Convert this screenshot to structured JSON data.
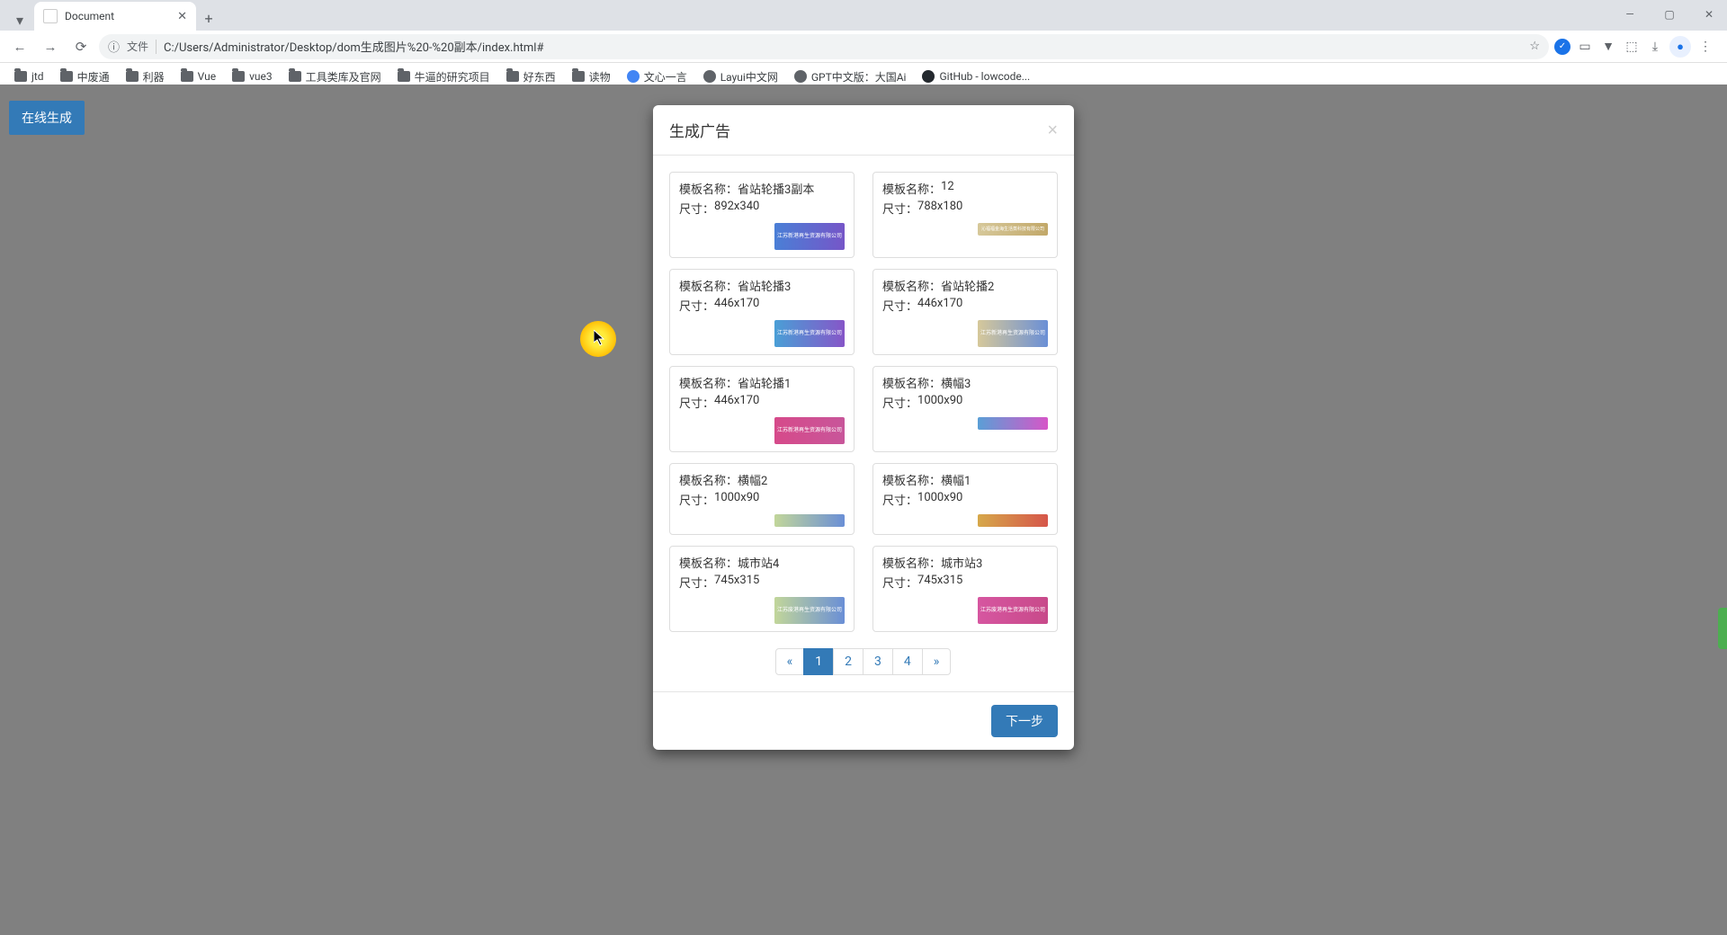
{
  "browser": {
    "tab_title": "Document",
    "url_file_label": "文件",
    "url": "C:/Users/Administrator/Desktop/dom生成图片%20-%20副本/index.html#",
    "bookmarks": [
      {
        "label": "jtd",
        "icon": "folder"
      },
      {
        "label": "中废通",
        "icon": "folder"
      },
      {
        "label": "利器",
        "icon": "folder"
      },
      {
        "label": "Vue",
        "icon": "folder"
      },
      {
        "label": "vue3",
        "icon": "folder"
      },
      {
        "label": "工具类库及官网",
        "icon": "folder"
      },
      {
        "label": "牛逼的研究项目",
        "icon": "folder"
      },
      {
        "label": "好东西",
        "icon": "folder"
      },
      {
        "label": "读物",
        "icon": "folder"
      },
      {
        "label": "文心一言",
        "icon": "blue"
      },
      {
        "label": "Layui中文网",
        "icon": "circle"
      },
      {
        "label": "GPT中文版：大国Ai",
        "icon": "circle"
      },
      {
        "label": "GitHub - lowcode...",
        "icon": "github"
      }
    ]
  },
  "page": {
    "generate_button": "在线生成"
  },
  "modal": {
    "title": "生成广告",
    "next_button": "下一步",
    "labels": {
      "name": "模板名称：",
      "size": "尺寸："
    },
    "templates": [
      {
        "name": "省站轮播3副本",
        "size": "892x340",
        "thumb_class": "grad-blue-purple",
        "thumb_text": "江苏新港再生资源有限公司"
      },
      {
        "name": "12",
        "size": "788x180",
        "thumb_class": "grad-gold short",
        "thumb_text": "沁福福金海生活蒸科技有限公司"
      },
      {
        "name": "省站轮播3",
        "size": "446x170",
        "thumb_class": "grad-gradient1",
        "thumb_text": "江苏新港再生资源有限公司"
      },
      {
        "name": "省站轮播2",
        "size": "446x170",
        "thumb_class": "grad-gold-blue",
        "thumb_text": "江苏新港再生资源有限公司"
      },
      {
        "name": "省站轮播1",
        "size": "446x170",
        "thumb_class": "grad-pink",
        "thumb_text": "江苏新港再生资源有限公司"
      },
      {
        "name": "横幅3",
        "size": "1000x90",
        "thumb_class": "grad-blue-pink short",
        "thumb_text": ""
      },
      {
        "name": "横幅2",
        "size": "1000x90",
        "thumb_class": "grad-lightblue short",
        "thumb_text": ""
      },
      {
        "name": "横幅1",
        "size": "1000x90",
        "thumb_class": "grad-orange short",
        "thumb_text": ""
      },
      {
        "name": "城市站4",
        "size": "745x315",
        "thumb_class": "grad-lightblue",
        "thumb_text": "江苏废港再生资源有限公司"
      },
      {
        "name": "城市站3",
        "size": "745x315",
        "thumb_class": "grad-magenta",
        "thumb_text": "江苏废港再生资源有限公司"
      }
    ],
    "pagination": {
      "prev": "«",
      "pages": [
        "1",
        "2",
        "3",
        "4"
      ],
      "active_index": 0,
      "next": "»"
    }
  }
}
